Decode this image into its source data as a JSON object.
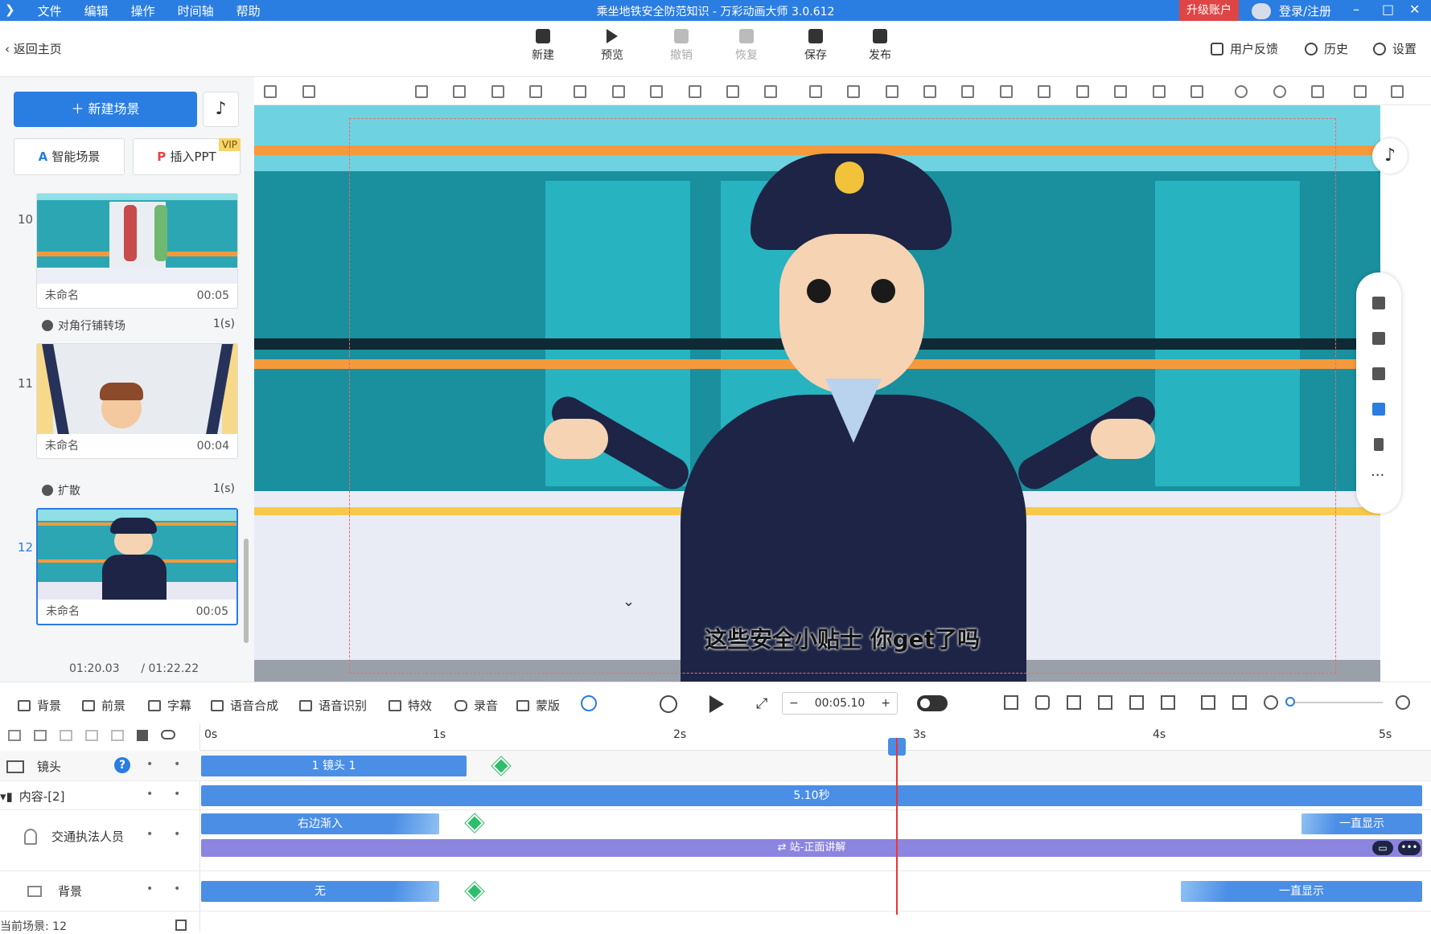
{
  "titlebar": {
    "menu": [
      "文件",
      "编辑",
      "操作",
      "时间轴",
      "帮助"
    ],
    "title": "乘坐地铁安全防范知识 - 万彩动画大师 3.0.612",
    "upgrade": "升级账户",
    "login": "登录/注册"
  },
  "toolbar": {
    "back": "返回主页",
    "buttons": [
      "新建",
      "预览",
      "撤销",
      "恢复",
      "保存",
      "发布"
    ],
    "right": [
      "用户反馈",
      "历史",
      "设置"
    ]
  },
  "left": {
    "new_scene": "新建场景",
    "smart_scene": "智能场景",
    "insert_ppt": "插入PPT",
    "vip": "VIP",
    "scenes": [
      {
        "num": "10",
        "name": "未命名",
        "dur": "00:05"
      },
      {
        "num": "11",
        "name": "未命名",
        "dur": "00:04"
      },
      {
        "num": "12",
        "name": "未命名",
        "dur": "00:05"
      }
    ],
    "transitions": [
      {
        "name": "对角行铺转场",
        "dur": "1(s)"
      },
      {
        "name": "扩散",
        "dur": "1(s)"
      }
    ],
    "current_time": "01:20.03",
    "total_time": "/ 01:22.22"
  },
  "stage": {
    "subtitle": "这些安全小贴士 你get了吗"
  },
  "tlbar": {
    "items": [
      "背景",
      "前景",
      "字幕",
      "语音合成",
      "语音识别",
      "特效",
      "录音",
      "蒙版"
    ],
    "time": "00:05.10",
    "minus": "−",
    "plus": "+"
  },
  "timeline": {
    "ticks": [
      "0s",
      "1s",
      "2s",
      "3s",
      "4s",
      "5s"
    ],
    "rows": [
      {
        "label": "镜头",
        "segments": [
          "1 镜头 1"
        ]
      },
      {
        "label": "内容-[2]",
        "segments": [
          "5.10秒"
        ]
      },
      {
        "label": "交通执法人员",
        "segments": [
          "右边渐入",
          "一直显示",
          "站-正面讲解"
        ]
      },
      {
        "label": "背景",
        "segments": [
          "无",
          "一直显示"
        ]
      }
    ],
    "status": "当前场景: 12"
  },
  "colors": {
    "brand": "#2a7de1",
    "upgrade": "#e04545",
    "segment_blue": "#4a8ee6",
    "segment_purple": "#8b85e0",
    "keyframe": "#2ebd6b",
    "playhead": "#e33333"
  }
}
